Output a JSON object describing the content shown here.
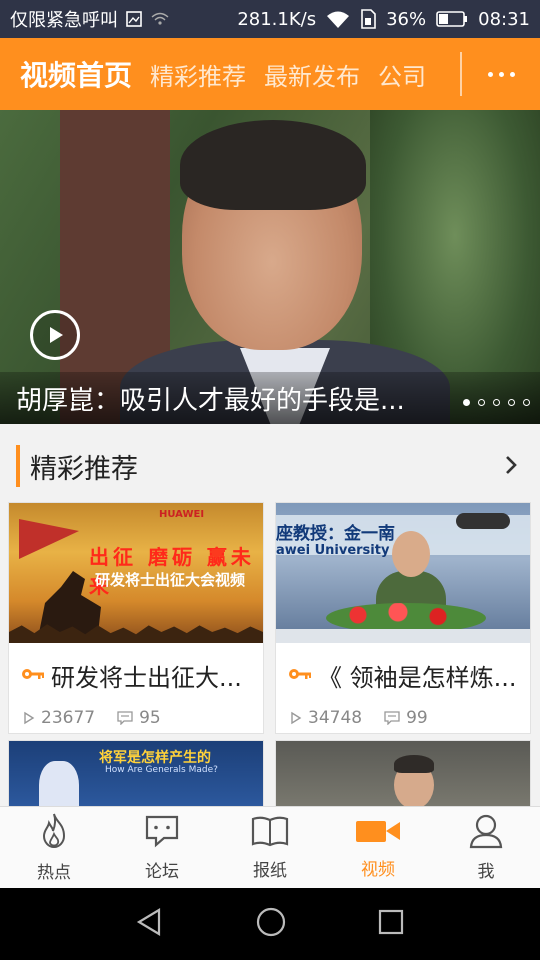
{
  "status_bar": {
    "carrier": "仅限紧急呼叫",
    "speed": "281.1K/s",
    "battery_pct": "36%",
    "time": "08:31",
    "icons": [
      "image-icon",
      "signal-icon",
      "wifi-icon",
      "sim-icon",
      "battery-icon"
    ]
  },
  "top_nav": {
    "tabs": [
      {
        "label": "视频首页",
        "active": true
      },
      {
        "label": "精彩推荐",
        "active": false
      },
      {
        "label": "最新发布",
        "active": false
      },
      {
        "label": "公司",
        "active": false
      }
    ],
    "more_icon": "more-dots-icon"
  },
  "hero": {
    "title": "胡厚崑：吸引人才最好的手段是...",
    "slide_count": 5,
    "active_slide": 1,
    "play_icon": "play-icon"
  },
  "section": {
    "title": "精彩推荐",
    "arrow_icon": "chevron-right-icon"
  },
  "cards": [
    {
      "title": "研发将士出征大...",
      "views": "23677",
      "comments": "95",
      "thumb_text": "出征 磨砺 赢未来",
      "thumb_sub": "研发将士出征大会视频",
      "thumb_logo": "HUAWEI"
    },
    {
      "title": "《 领袖是怎样炼...",
      "views": "34748",
      "comments": "99",
      "thumb_text": "座教授：金一南",
      "thumb_sub": "awei University"
    },
    {
      "title": "",
      "thumb_text": "将军是怎样产生的",
      "thumb_sub": "How Are Generals Made?"
    },
    {
      "title": ""
    }
  ],
  "tab_bar": {
    "tabs": [
      {
        "label": "热点",
        "icon": "fire-icon",
        "active": false
      },
      {
        "label": "论坛",
        "icon": "chat-bubble-icon",
        "active": false
      },
      {
        "label": "报纸",
        "icon": "book-icon",
        "active": false
      },
      {
        "label": "视频",
        "icon": "video-camera-icon",
        "active": true
      },
      {
        "label": "我",
        "icon": "person-icon",
        "active": false
      }
    ]
  },
  "colors": {
    "accent": "#ff8f1e",
    "status_bar": "#2f3447"
  }
}
